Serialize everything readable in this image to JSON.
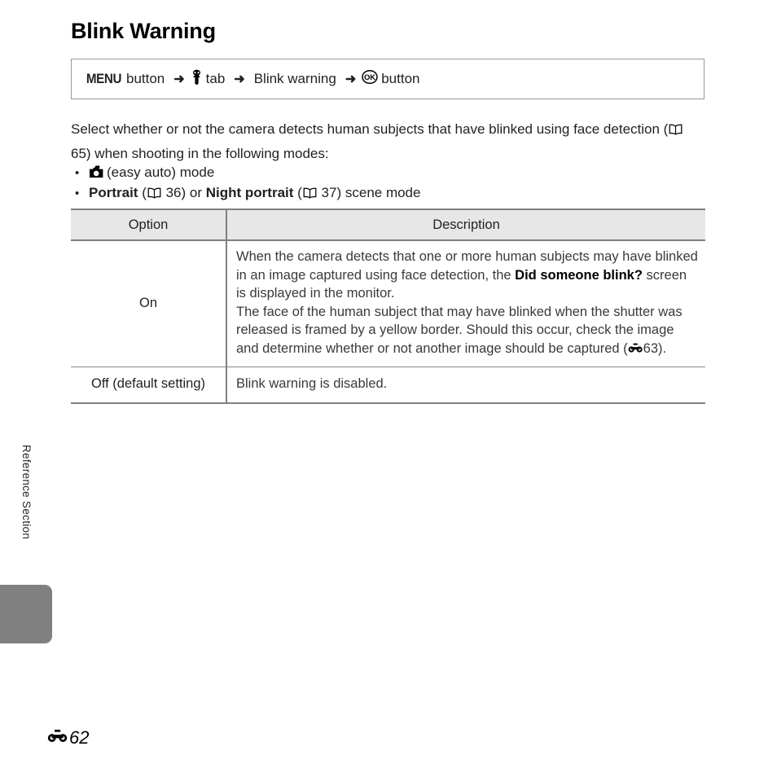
{
  "page": {
    "title": "Blink Warning",
    "section_label": "Reference Section",
    "footer_page_number": "62",
    "footer_icon": "reference-section-icon"
  },
  "menu_path": {
    "menu_button_label": "MENU",
    "button_word_1": "button",
    "arrow": "➜",
    "setup_tab_icon": "wrench-icon",
    "tab_word": "tab",
    "menu_item": "Blink warning",
    "ok_button_icon": "ok-button-icon",
    "button_word_2": "button"
  },
  "intro": {
    "text_part_1": "Select whether or not the camera detects human subjects that have blinked using face detection (",
    "book_icon": "book-icon",
    "page_ref": "65",
    "text_part_2": ") when shooting in the following modes:"
  },
  "modes": [
    {
      "bullet": "•",
      "icon": "easy-auto-camera-icon",
      "label_bold": "",
      "text": "(easy auto) mode",
      "page_ref": ""
    },
    {
      "bullet": "•",
      "icon": "",
      "label_bold": "Portrait",
      "page_ref_1": "36",
      "conjunction": "or",
      "label_bold_2": "Night portrait",
      "page_ref_2": "37",
      "trailing": "scene mode"
    }
  ],
  "table": {
    "headers": {
      "option": "Option",
      "description": "Description"
    },
    "rows": [
      {
        "option": "On",
        "description_lines": [
          "When the camera detects that one or more human subjects may have blinked in an image captured using face detection, the ",
          "Did someone blink?",
          " screen is displayed in the monitor.",
          "The face of the human subject that may have blinked when the shutter was released is framed by a yellow border. Should this occur, check the image and determine whether or not another image should be captured (",
          "63",
          ")."
        ],
        "ref_icon": "reference-section-icon"
      },
      {
        "option": "Off (default setting)",
        "description": "Blink warning is disabled."
      }
    ]
  },
  "colors": {
    "table_header_bg": "#e7e7e7",
    "table_border": "#808080",
    "side_tab": "#808080",
    "body_text": "#3a3a3a",
    "heading": "#000000"
  }
}
